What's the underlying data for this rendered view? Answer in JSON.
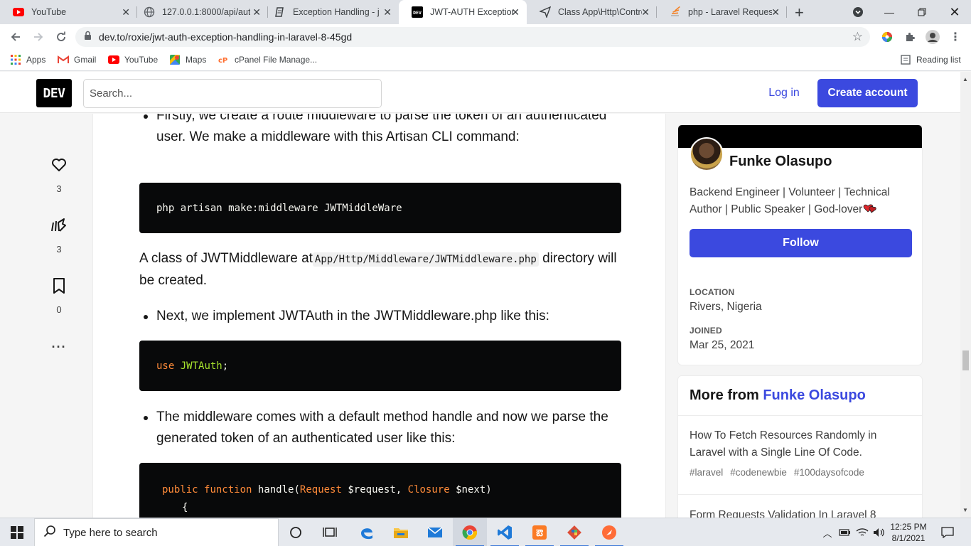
{
  "browser": {
    "tabs": [
      {
        "label": "YouTube",
        "icon": "youtube-icon"
      },
      {
        "label": "127.0.0.1:8000/api/aut",
        "icon": "globe-icon"
      },
      {
        "label": "Exception Handling - j",
        "icon": "doc-icon"
      },
      {
        "label": "JWT-AUTH Exception H",
        "icon": "dev-icon",
        "active": true
      },
      {
        "label": "Class App\\Http\\Contro",
        "icon": "send-icon"
      },
      {
        "label": "php - Laravel Request",
        "icon": "stack-icon"
      }
    ],
    "url": "dev.to/roxie/jwt-auth-exception-handling-in-laravel-8-45gd",
    "bookmarks": [
      "Apps",
      "Gmail",
      "YouTube",
      "Maps",
      "cPanel File Manage..."
    ],
    "reading_list": "Reading list"
  },
  "dev": {
    "logo": "DEV",
    "search_placeholder": "Search...",
    "login": "Log in",
    "create_account": "Create account"
  },
  "reactions": {
    "likes": "3",
    "unicorns": "3",
    "bookmarks": "0"
  },
  "article": {
    "bullet1": "Firstly, we create a route middleware to parse the token of an authenticated user. We make a middleware with this Artisan CLI command:",
    "code1": "php artisan make:middleware JWTMiddleWare",
    "para1_pre": "A class of JWTMiddleware at",
    "para1_code": "App/Http/Middleware/JWTMiddleware.php",
    "para1_post": " directory will be created.",
    "bullet2": "Next, we implement JWTAuth in the JWTMiddleware.php like this:",
    "code2_kw": "use",
    "code2_name": "JWTAuth",
    "code2_end": ";",
    "bullet3": "The middleware comes with a default method handle and now we parse the generated token of an authenticated user like this:",
    "code3_public": "public",
    "code3_function": "function",
    "code3_name": "handle(",
    "code3_request": "Request",
    "code3_var1": " $request, ",
    "code3_closure": "Closure",
    "code3_var2": " $next)",
    "code3_brace": "{"
  },
  "author": {
    "name": "Funke Olasupo",
    "bio": "Backend Engineer | Volunteer | Technical Author | Public Speaker | God-lover",
    "follow": "Follow",
    "location_label": "LOCATION",
    "location": "Rivers, Nigeria",
    "joined_label": "JOINED",
    "joined": "Mar 25, 2021"
  },
  "more_from": {
    "prefix": "More from ",
    "author": "Funke Olasupo",
    "posts": [
      {
        "title": "How To Fetch Resources Randomly in Laravel with a Single Line Of Code.",
        "tags": [
          "#laravel",
          "#codenewbie",
          "#100daysofcode"
        ]
      },
      {
        "title": "Form Requests Validation In Laravel 8",
        "tags": []
      }
    ]
  },
  "taskbar": {
    "search_text": "Type here to search",
    "time": "12:25 PM",
    "date": "8/1/2021"
  },
  "colors": {
    "accent": "#3b49df",
    "code_bg": "#08090a"
  }
}
